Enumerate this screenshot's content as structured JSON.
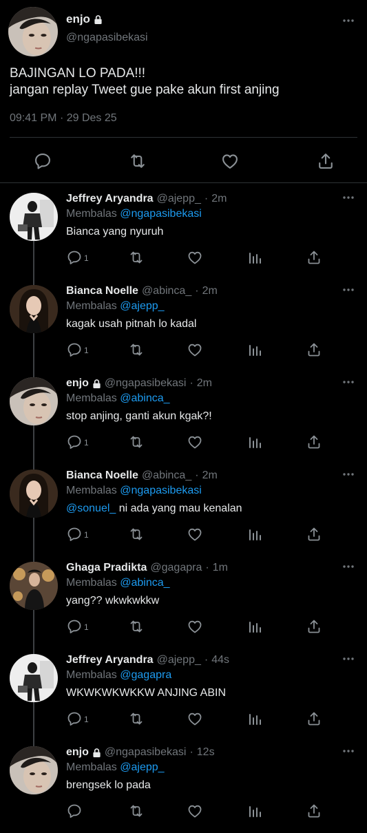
{
  "main_tweet": {
    "display_name": "enjo",
    "handle": "@ngapasibekasi",
    "text_line1": "BAJINGAN LO PADA!!!",
    "text_line2": "jangan replay Tweet gue pake akun first anjing",
    "time": "09:41 PM",
    "date_sep": "·",
    "date": "29 Des 25"
  },
  "replying_label": "Membalas",
  "replies": [
    {
      "name": "Jeffrey Aryandra",
      "handle": "@ajepp_",
      "sep": "·",
      "time": "2m",
      "reply_to": "@ngapasibekasi",
      "text": "Bianca yang nyuruh",
      "reply_count": "1"
    },
    {
      "name": "Bianca Noelle",
      "handle": "@abinca_",
      "sep": "·",
      "time": "2m",
      "reply_to": "@ajepp_",
      "text": "kagak usah pitnah lo kadal",
      "reply_count": "1"
    },
    {
      "name": "enjo",
      "handle": "@ngapasibekasi",
      "sep": "·",
      "time": "2m",
      "reply_to": "@abinca_",
      "text": "stop anjing, ganti akun kgak?!",
      "reply_count": "1"
    },
    {
      "name": "Bianca Noelle",
      "handle": "@abinca_",
      "sep": "·",
      "time": "2m",
      "reply_to": "@ngapasibekasi",
      "mention": "@sonuel_",
      "text": "ni ada yang mau kenalan",
      "reply_count": "1"
    },
    {
      "name": "Ghaga Pradikta",
      "handle": "@gagapra",
      "sep": "·",
      "time": "1m",
      "reply_to": "@abinca_",
      "text": "yang?? wkwkwkkw",
      "reply_count": "1"
    },
    {
      "name": "Jeffrey Aryandra",
      "handle": "@ajepp_",
      "sep": "·",
      "time": "44s",
      "reply_to": "@gagapra",
      "text": "WKWKWKWKKW ANJING ABIN",
      "reply_count": "1"
    },
    {
      "name": "enjo",
      "handle": "@ngapasibekasi",
      "sep": "·",
      "time": "12s",
      "reply_to": "@ajepp_",
      "text": "brengsek lo pada",
      "reply_count": ""
    }
  ],
  "icons": [
    "lock-icon",
    "more-icon",
    "reply-icon",
    "retweet-icon",
    "like-icon",
    "share-icon",
    "analytics-icon"
  ],
  "colors": {
    "background": "#000000",
    "text": "#e7e9ea",
    "muted": "#71767b",
    "link": "#1d9bf0",
    "divider": "#2f3336"
  }
}
